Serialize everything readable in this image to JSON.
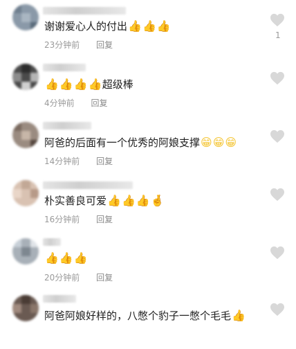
{
  "comments": [
    {
      "text": "谢谢爱心人的付出",
      "emojis": [
        "👍",
        "👍",
        "👍"
      ],
      "time": "23分钟前",
      "reply": "回复",
      "likes": "1"
    },
    {
      "text": "超级棒",
      "emoji_prefix": [
        "👍",
        "👍",
        "👍",
        "👍"
      ],
      "time": "4分钟前",
      "reply": "回复"
    },
    {
      "text": "阿爸的后面有一个优秀的阿娘支撑",
      "emojis": [
        "😁",
        "😁",
        "😁"
      ],
      "time": "14分钟前",
      "reply": "回复"
    },
    {
      "text": "朴实善良可爱",
      "emojis": [
        "👍",
        "👍",
        "👍",
        "🤞"
      ],
      "time": "16分钟前",
      "reply": "回复"
    },
    {
      "text": "",
      "emojis": [
        "👍",
        "👍",
        "👍"
      ],
      "time": "20分钟前",
      "reply": "回复"
    },
    {
      "text": "阿爸阿娘好样的，八憋个豹子一憋个毛毛",
      "emojis": [
        "👍"
      ],
      "time": "",
      "reply": ""
    }
  ],
  "icons": {
    "like": "heart-outline-icon"
  },
  "colors": {
    "meta": "#9a9a9a",
    "heart": "#cfcfcf",
    "thumb": "#f6b21b"
  }
}
